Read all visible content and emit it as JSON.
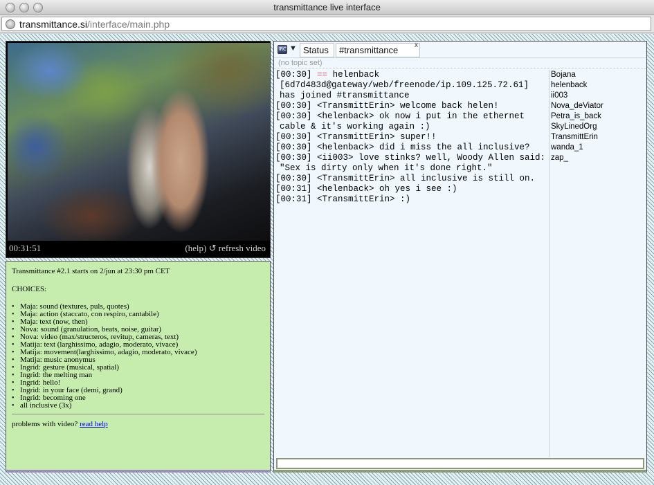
{
  "window": {
    "title": "transmittance live interface"
  },
  "address": {
    "host": "transmittance.si",
    "path": "/interface/main.php"
  },
  "video": {
    "time": "00:31:51",
    "help": "(help)",
    "refresh": "↺ refresh video"
  },
  "program": {
    "intro": "Transmittance #2.1 starts on 2/jun at 23:30 pm CET",
    "choices_heading": "CHOICES:",
    "choices": [
      "Maja: sound (textures, puls, quotes)",
      "Maja: action (staccato, con respiro, cantabile)",
      "Maja: text (now, then)",
      "Nova: sound (granulation, beats, noise, guitar)",
      "Nova: video (max/structeros, revitup, cameras, text)",
      "Matija: text (larghissimo, adagio, moderato, vivace)",
      "Matija: movement(larghissimo, adagio, moderato, vivace)",
      "Matija: music anonymus",
      "Ingrid: gesture (musical, spatial)",
      "Ingrid: the melting man",
      "Ingrid: hello!",
      "Ingrid: in your face (demi, grand)",
      "Ingrid: becoming one",
      "all inclusive (3x)"
    ],
    "help_text": "problems with video?",
    "help_link": "read help"
  },
  "chat": {
    "tabs": {
      "status": "Status",
      "channel": "#transmittance",
      "close": "x"
    },
    "topic": "(no topic set)",
    "join_marker": "==",
    "join_time": "[00:30]",
    "join_rest": "helenback [6d7d483d@gateway/web/freenode/ip.109.125.72.61] has joined #transmittance",
    "lines": [
      "[00:30] <TransmittErin> welcome back helen!",
      "[00:30] <helenback> ok now i put in the ethernet cable & it's working again :)",
      "[00:30] <TransmittErin> super!!",
      "[00:30] <helenback> did i miss the all inclusive?",
      "[00:30] <ii003> love stinks? well, Woody Allen said: \"Sex is dirty only when it's done right.\"",
      "[00:30] <TransmittErin> all inclusive is still on.",
      "[00:31] <helenback> oh yes i see :)",
      "[00:31] <TransmittErin> :)"
    ],
    "nicks": [
      "Bojana",
      "helenback",
      "ii003",
      "Nova_deViator",
      "Petra_is_back",
      "SkyLinedOrg",
      "TransmittErin",
      "wanda_1",
      "zap_"
    ],
    "input_value": ""
  }
}
